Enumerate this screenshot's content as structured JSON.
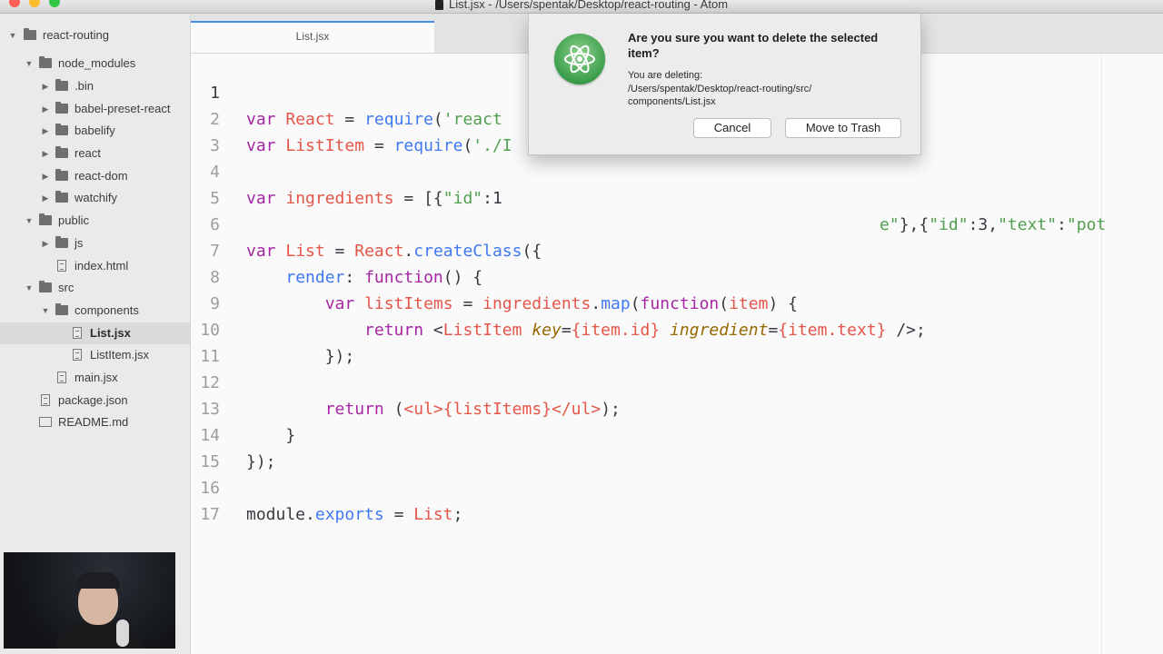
{
  "window": {
    "title": "List.jsx - /Users/spentak/Desktop/react-routing - Atom"
  },
  "sidebar": {
    "items": [
      {
        "label": "react-routing",
        "kind": "folder",
        "expanded": true
      },
      {
        "label": "node_modules",
        "kind": "folder",
        "expanded": true
      },
      {
        "label": ".bin",
        "kind": "folder",
        "expanded": false
      },
      {
        "label": "babel-preset-react",
        "kind": "folder",
        "expanded": false
      },
      {
        "label": "babelify",
        "kind": "folder",
        "expanded": false
      },
      {
        "label": "react",
        "kind": "folder",
        "expanded": false
      },
      {
        "label": "react-dom",
        "kind": "folder",
        "expanded": false
      },
      {
        "label": "watchify",
        "kind": "folder",
        "expanded": false
      },
      {
        "label": "public",
        "kind": "folder",
        "expanded": true
      },
      {
        "label": "js",
        "kind": "folder",
        "expanded": false
      },
      {
        "label": "index.html",
        "kind": "file"
      },
      {
        "label": "src",
        "kind": "folder",
        "expanded": true
      },
      {
        "label": "components",
        "kind": "folder",
        "expanded": true
      },
      {
        "label": "List.jsx",
        "kind": "file",
        "selected": true
      },
      {
        "label": "ListItem.jsx",
        "kind": "file"
      },
      {
        "label": "main.jsx",
        "kind": "file"
      },
      {
        "label": "package.json",
        "kind": "file"
      },
      {
        "label": "README.md",
        "kind": "book"
      }
    ]
  },
  "tabs": [
    {
      "label": "List.jsx",
      "active": true
    }
  ],
  "editor": {
    "line_numbers": [
      "1",
      "2",
      "3",
      "4",
      "5",
      "6",
      "7",
      "8",
      "9",
      "10",
      "11",
      "12",
      "13",
      "14",
      "15",
      "16",
      "17"
    ],
    "lines": {
      "l1": [
        "var",
        " ",
        "React",
        " = ",
        "require",
        "(",
        "'react"
      ],
      "l2": [
        "var",
        " ",
        "ListItem",
        " = ",
        "require",
        "(",
        "'./I"
      ],
      "l4": [
        "var",
        " ",
        "ingredients",
        " = [{",
        "\"id\"",
        ":1",
        "e\"",
        "},{",
        "\"id\"",
        ":3,",
        "\"text\"",
        ":",
        "\"pot"
      ],
      "l6": [
        "var",
        " ",
        "List",
        " = ",
        "React",
        ".",
        "createClass",
        "({"
      ],
      "l7": [
        "    ",
        "render",
        ": ",
        "function",
        "() {"
      ],
      "l8": [
        "        ",
        "var",
        " ",
        "listItems",
        " = ",
        "ingredients",
        ".",
        "map",
        "(",
        "function",
        "(",
        "item",
        ") {"
      ],
      "l9": [
        "            ",
        "return",
        " <",
        "ListItem",
        " ",
        "key",
        "=",
        "{item.id}",
        " ",
        "ingredient",
        "=",
        "{item.text}",
        " />;"
      ],
      "l10": [
        "        });"
      ],
      "l12": [
        "        ",
        "return",
        " (",
        "<ul>",
        "{listItems}",
        "</ul>",
        ");"
      ],
      "l13": [
        "    }"
      ],
      "l14": [
        "});"
      ],
      "l16": [
        "module",
        ".",
        "exports",
        " = ",
        "List",
        ";"
      ]
    }
  },
  "dialog": {
    "title": "Are you sure you want to delete the selected item?",
    "message": "You are deleting:\n/Users/spentak/Desktop/react-routing/src/\ncomponents/List.jsx",
    "cancel_label": "Cancel",
    "confirm_label": "Move to Trash"
  },
  "colors": {
    "keyword": "#a626a4",
    "function": "#4078f2",
    "string": "#50a14f",
    "variable": "#e45649",
    "attribute": "#986801",
    "accent": "#4a8fe2"
  }
}
